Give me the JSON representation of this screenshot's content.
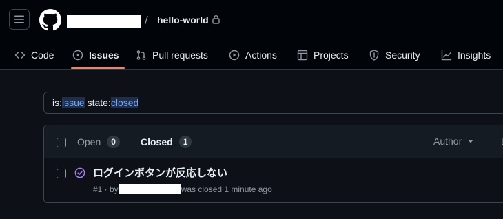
{
  "header": {
    "repo_name": "hello-world",
    "slash": "/"
  },
  "nav": {
    "tabs": [
      {
        "label": "Code",
        "icon": "code-icon"
      },
      {
        "label": "Issues",
        "icon": "issue-opened-icon",
        "selected": true
      },
      {
        "label": "Pull requests",
        "icon": "git-pull-request-icon"
      },
      {
        "label": "Actions",
        "icon": "play-icon"
      },
      {
        "label": "Projects",
        "icon": "table-icon"
      },
      {
        "label": "Security",
        "icon": "shield-icon"
      },
      {
        "label": "Insights",
        "icon": "graph-icon"
      }
    ]
  },
  "search": {
    "prefix1": "is:",
    "value1": "issue",
    "prefix2": " state:",
    "value2": "closed"
  },
  "list": {
    "open_label": "Open",
    "open_count": "0",
    "closed_label": "Closed",
    "closed_count": "1",
    "author_label": "Author",
    "label_stub": "L"
  },
  "issues": [
    {
      "title": "ログインボタンが反応しない",
      "meta_prefix": "#1 · by",
      "meta_suffix": "was closed 1 minute ago",
      "status_color": "#ab7df8"
    }
  ],
  "colors": {
    "accent_underline": "#f78166",
    "closed_purple": "#ab7df8"
  }
}
